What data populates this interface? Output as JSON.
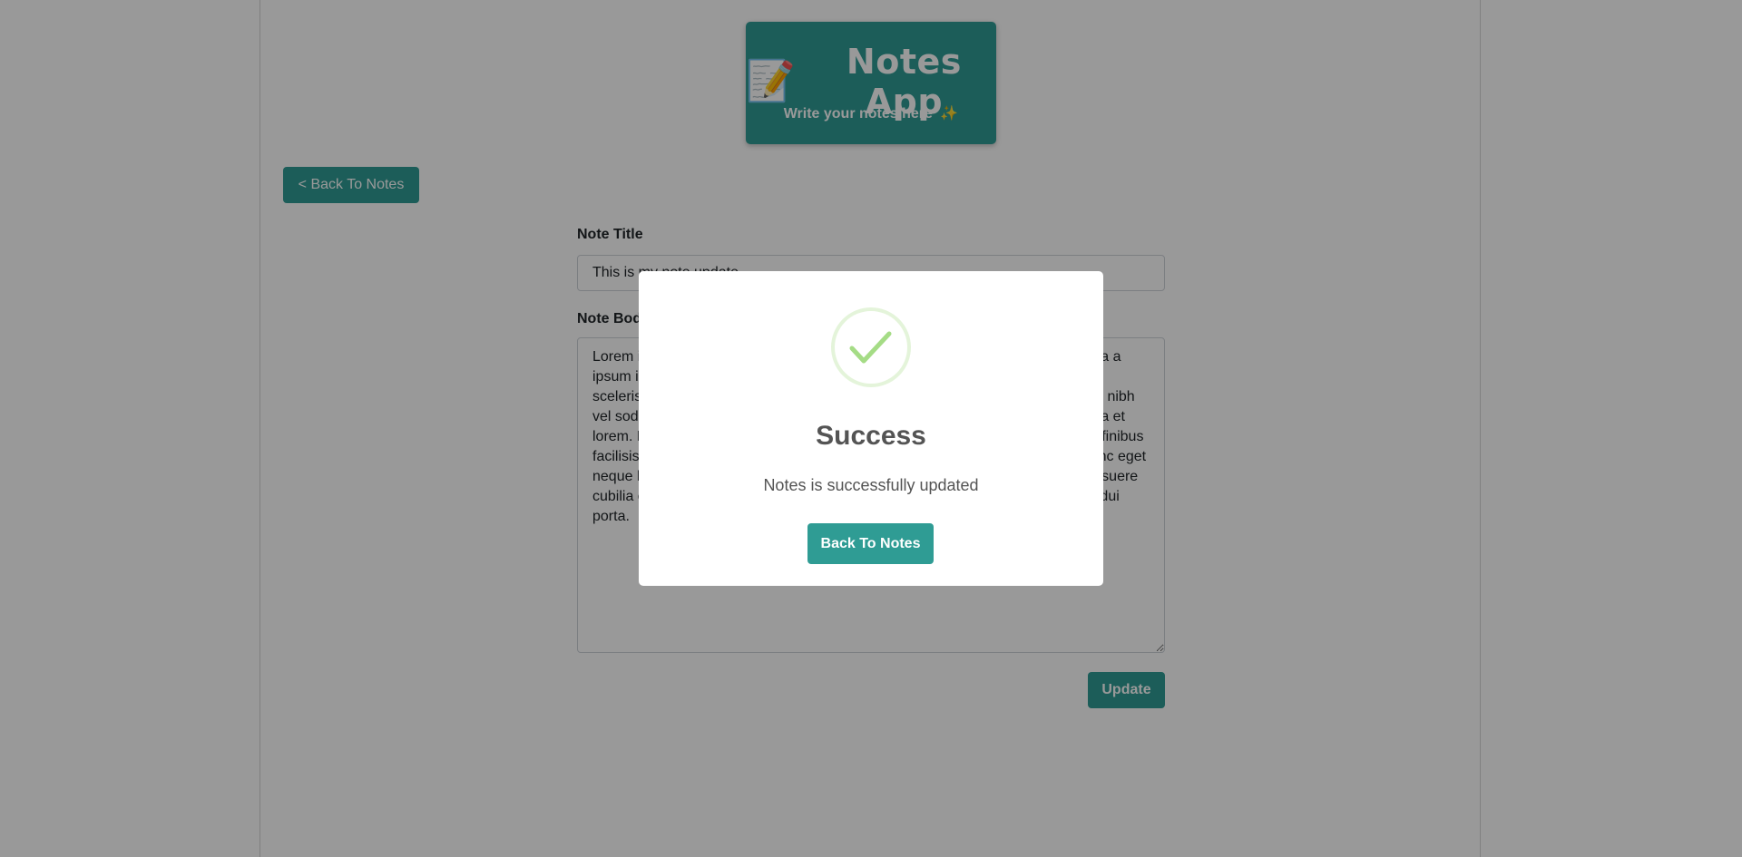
{
  "header": {
    "icon": "memo-icon",
    "icon_glyph": "📝",
    "title": "Notes App",
    "subtitle": "Write your notes here",
    "subtitle_emoji": "✨"
  },
  "nav": {
    "back_label": "< Back To Notes"
  },
  "form": {
    "title_label": "Note Title",
    "title_value": "This is my note update",
    "body_label": "Note Body",
    "body_value": "Lorem ipsum dolor sit amet, consectetur adipiscing elit. Pellentesque malesuada a ipsum in lacinia. Nullam vel justo at nisi tempus mollis. Vivamus scelerisque scelerisque sapien, eget feugiat libero tincidunt vitae. Vestibulum condimentum, nibh vel sodales tincidunt, lacus ante pulvinar massa, id posuere augue enim, fringilla et lorem. Donec ut felis vitae elit rhoncus placerat. Pellentesque id libero ac ligula finibus facilisis et in nisi. Sed non tellus eget dui luctus rhoncus. Maecenas ultricies nunc eget neque laoreet, in porta ex cursus. Vestibulum ut massa orci luctus et ultrices posuere cubilia curae; Suspendisse potenti in justo vitae fringilla. Cras consequat elit at dui porta.",
    "update_label": "Update"
  },
  "modal": {
    "icon": "success-check-icon",
    "title": "Success",
    "message": "Notes is successfully updated",
    "confirm_label": "Back To Notes"
  },
  "colors": {
    "primary": "#2f9c94",
    "overlay": "rgba(0,0,0,0.4)",
    "success_check": "#a5dc86",
    "sparkle": "#f2c531"
  }
}
